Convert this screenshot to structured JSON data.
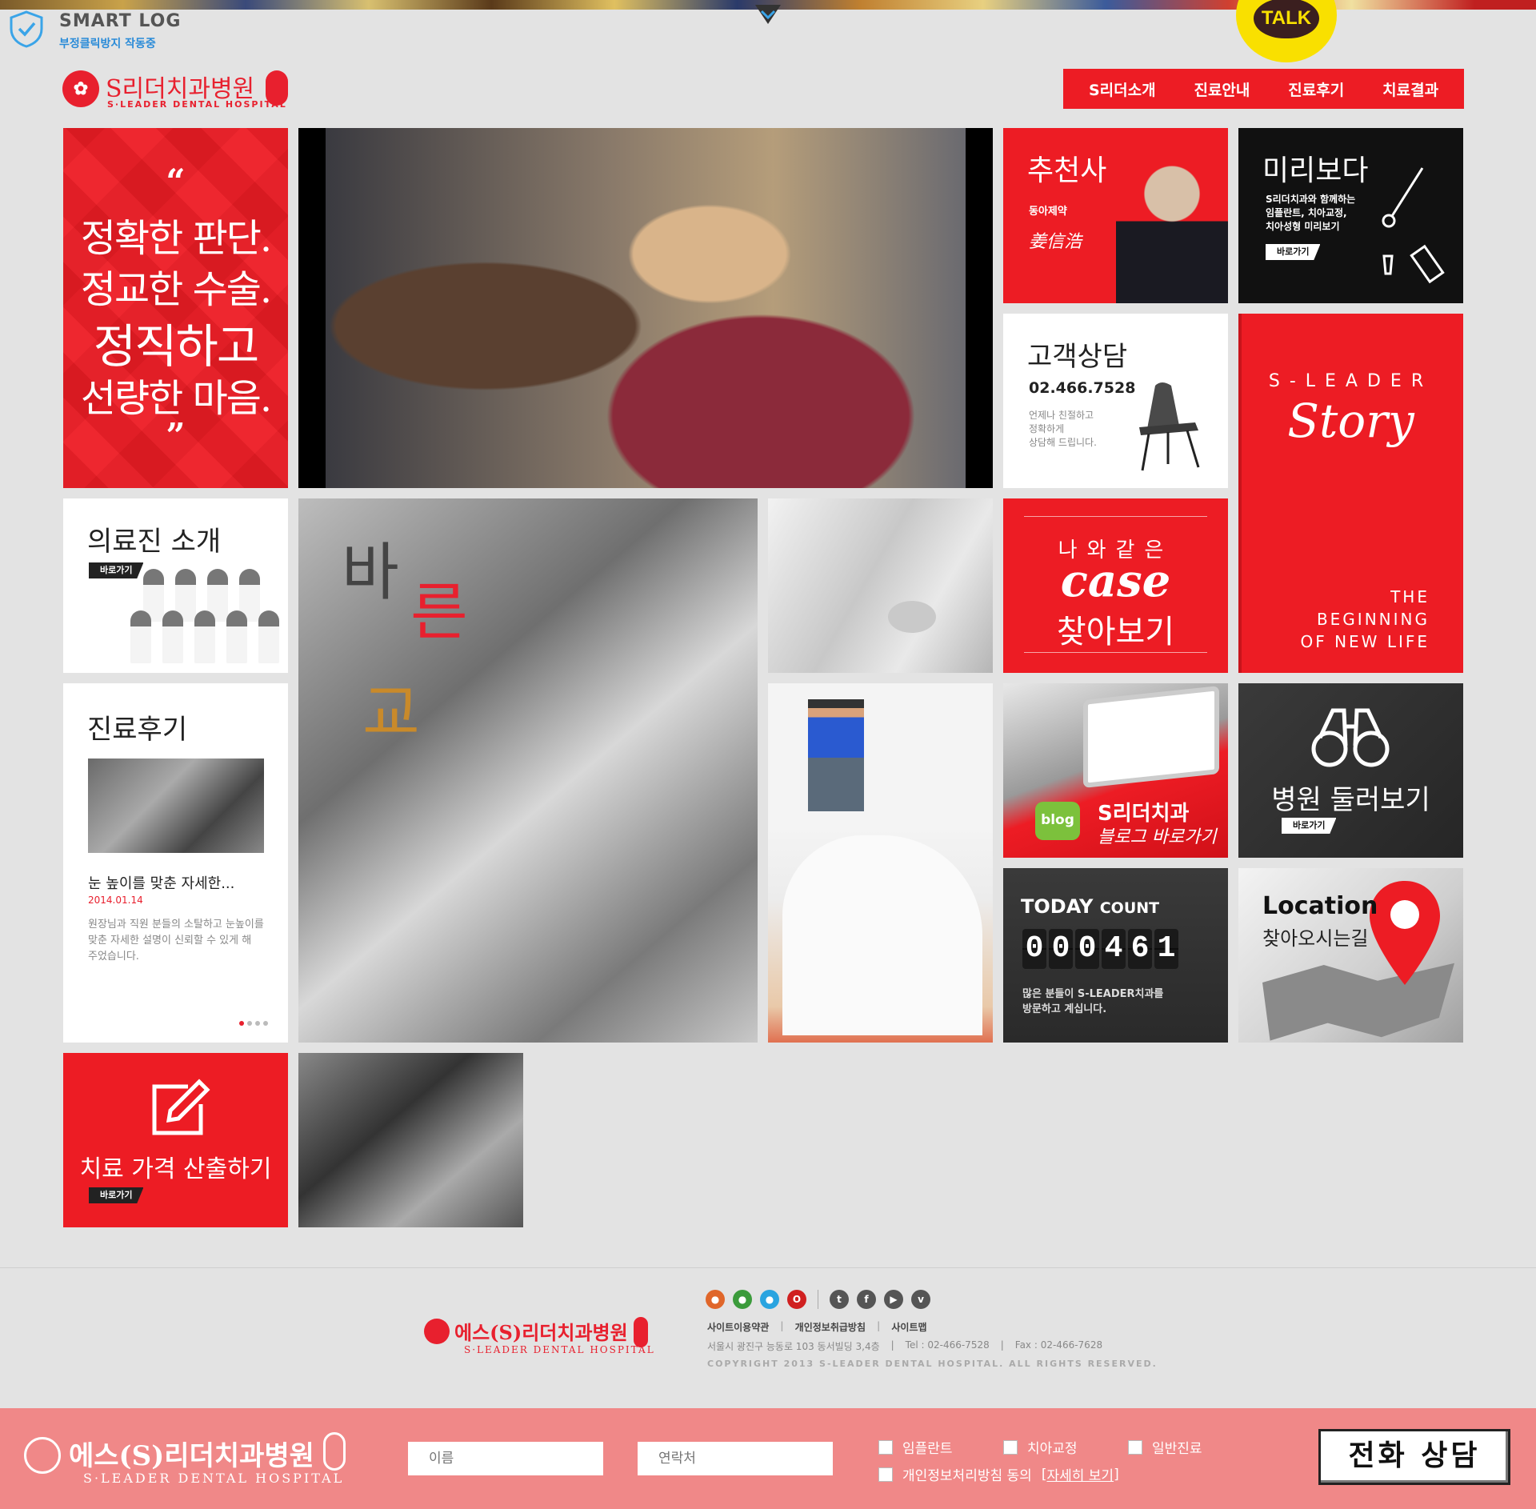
{
  "smartlog": {
    "title": "SMART LOG",
    "subtitle": "부정클릭방지 작동중"
  },
  "kakao": {
    "label": "TALK"
  },
  "header": {
    "logo_name": "S리더치과병원",
    "logo_en": "S·LEADER DENTAL HOSPITAL",
    "nav": [
      "S리더소개",
      "진료안내",
      "진료후기",
      "치료결과"
    ]
  },
  "tiles": {
    "quote": {
      "open": "“",
      "close": "”",
      "lines": [
        "정확한 판단.",
        "정교한 수술.",
        "정직하고",
        "선량한 마음."
      ]
    },
    "recommend": {
      "title": "추천사",
      "brand": "동아제약",
      "signature": "姜信浩"
    },
    "preview": {
      "title": "미리보다",
      "desc_lines": [
        "S리더치과와 함께하는",
        "임플란트, 치아교정,",
        "치아성형 미리보기"
      ],
      "button": "바로가기"
    },
    "consult": {
      "title": "고객상담",
      "phone": "02.466.7528",
      "desc_lines": [
        "언제나 친절하고",
        "정확하게",
        "상담해 드립니다."
      ]
    },
    "story": {
      "sub": "S-LEADER",
      "main": "Story",
      "foot_lines": [
        "THE",
        "BEGINNING",
        "OF NEW LIFE"
      ]
    },
    "staff": {
      "title": "의료진 소개",
      "button": "바로가기"
    },
    "bareun": {
      "chars": [
        "바",
        "른",
        "교"
      ]
    },
    "case": {
      "small": "나와같은",
      "big": "case",
      "korean": "찾아보기"
    },
    "review": {
      "title": "진료후기",
      "item_title": "눈 높이를 맞춘 자세한...",
      "item_date": "2014.01.14",
      "item_text": "원장님과 직원 분들의 소탈하고 눈높이를 맞춘 자세한 설명이 신뢰할 수 있게 해 주었습니다."
    },
    "blog": {
      "badge": "blog",
      "title": "S리더치과",
      "sub": "블로그 바로가기"
    },
    "tour": {
      "title": "병원 둘러보기",
      "button": "바로가기"
    },
    "count": {
      "title": "TODAY",
      "title_small": "COUNT",
      "digits": [
        "0",
        "0",
        "0",
        "4",
        "6",
        "1"
      ],
      "note_lines": [
        "많은 분들이 S-LEADER치과를",
        "방문하고 계십니다."
      ]
    },
    "location": {
      "title": "Location",
      "sub": "찾아오시는길"
    },
    "price": {
      "title": "치료 가격 산출하기",
      "button": "바로가기"
    }
  },
  "footer": {
    "logo_name": "에스(S)리더치과병원",
    "logo_en": "S·LEADER DENTAL HOSPITAL",
    "links": [
      "사이트이용약관",
      "개인정보취급방침",
      "사이트맵"
    ],
    "address": "서울시 광진구 능동로 103 동서빌딩 3,4층",
    "tel": "Tel : 02-466-7528",
    "fax": "Fax : 02-466-7628",
    "copyright": "COPYRIGHT 2013 S-LEADER DENTAL HOSPITAL. ALL RIGHTS RESERVED."
  },
  "bottom_bar": {
    "logo_name": "에스(S)리더치과병원",
    "logo_en": "S·LEADER DENTAL HOSPITAL",
    "name_placeholder": "이름",
    "phone_placeholder": "연락처",
    "checks": [
      "임플란트",
      "치아교정",
      "일반진료"
    ],
    "privacy_label": "개인정보처리방침 동의",
    "privacy_link": "자세히 보기",
    "call_button": "전화 상담"
  },
  "colors": {
    "brand_red": "#ed1c24",
    "background": "#e3e3e3",
    "bottom_bar": "#f08888"
  }
}
